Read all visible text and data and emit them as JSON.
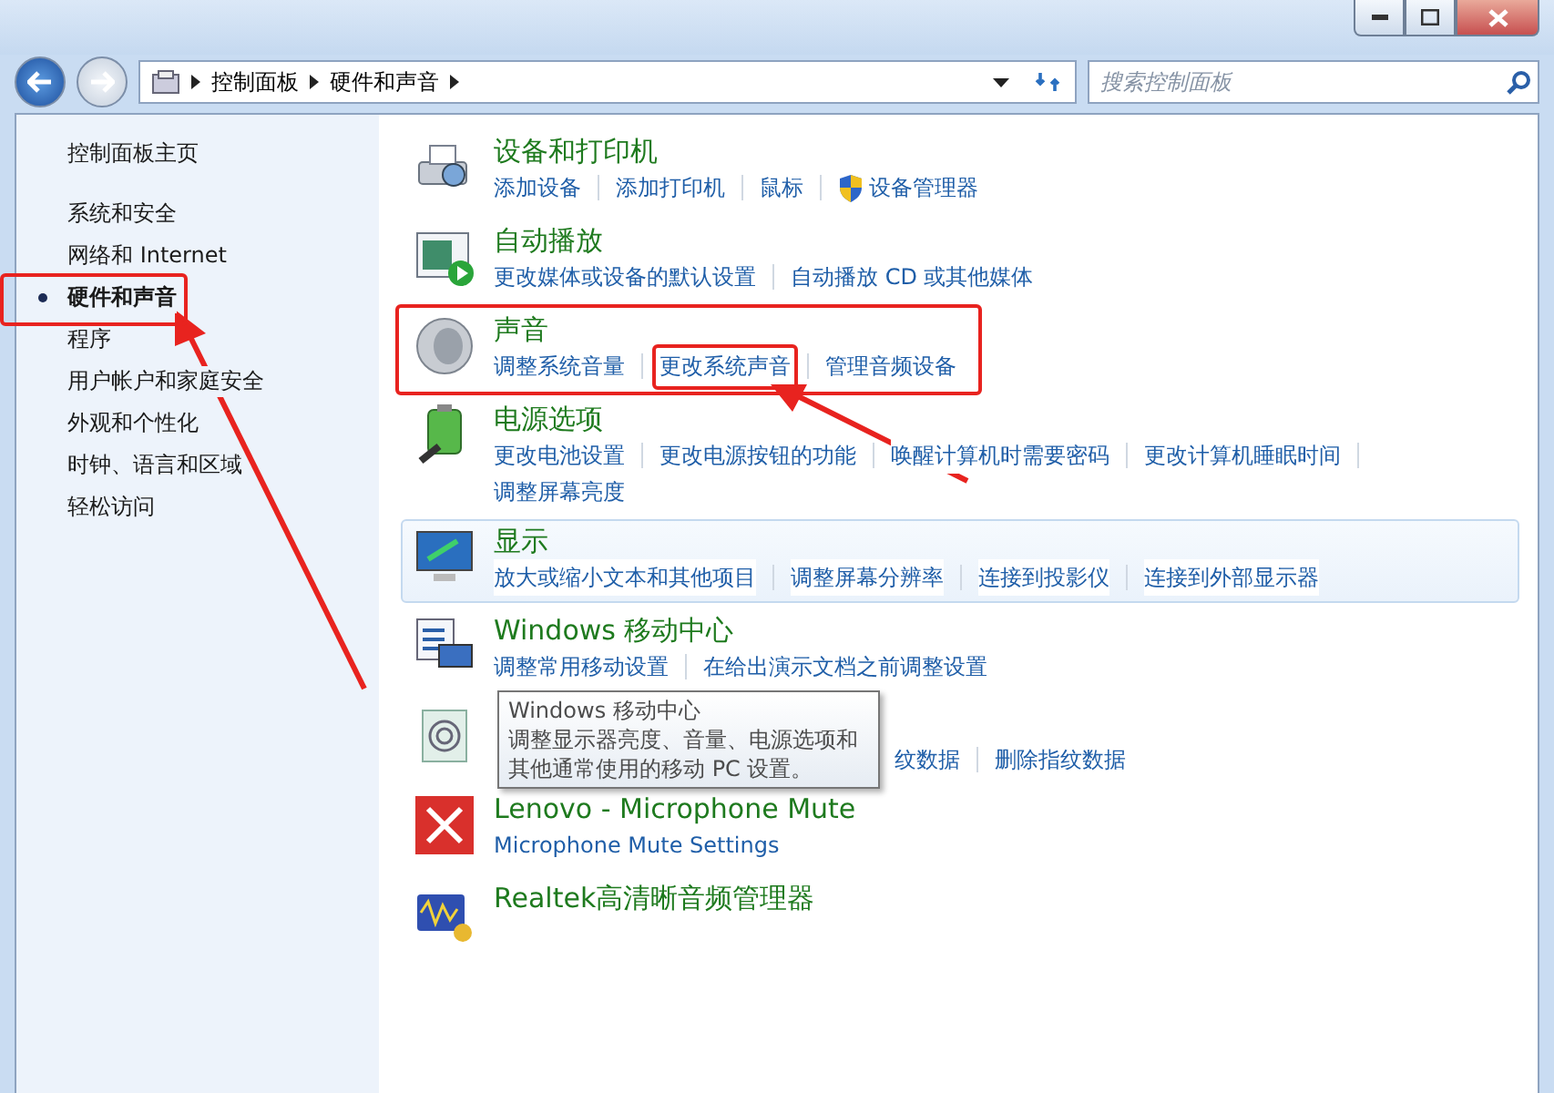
{
  "address_bar": {
    "breadcrumbs": [
      "控制面板",
      "硬件和声音"
    ],
    "search": {
      "placeholder": "搜索控制面板"
    }
  },
  "sidebar": {
    "home": "控制面板主页",
    "items": [
      {
        "label": "系统和安全",
        "selected": false,
        "annotated": false
      },
      {
        "label": "网络和 Internet",
        "selected": false,
        "annotated": false
      },
      {
        "label": "硬件和声音",
        "selected": true,
        "annotated": true
      },
      {
        "label": "程序",
        "selected": false,
        "annotated": false
      },
      {
        "label": "用户帐户和家庭安全",
        "selected": false,
        "annotated": false
      },
      {
        "label": "外观和个性化",
        "selected": false,
        "annotated": false
      },
      {
        "label": "时钟、语言和区域",
        "selected": false,
        "annotated": false
      },
      {
        "label": "轻松访问",
        "selected": false,
        "annotated": false
      }
    ]
  },
  "categories": [
    {
      "title": "设备和打印机",
      "highlighted": false,
      "annotated": false,
      "links": [
        {
          "text": "添加设备",
          "kind": "plain",
          "annotated": false
        },
        {
          "text": "添加打印机",
          "kind": "plain",
          "annotated": false
        },
        {
          "text": "鼠标",
          "kind": "plain",
          "annotated": false
        },
        {
          "text": "设备管理器",
          "kind": "shield",
          "annotated": false
        }
      ]
    },
    {
      "title": "自动播放",
      "highlighted": false,
      "annotated": false,
      "links": [
        {
          "text": "更改媒体或设备的默认设置",
          "kind": "plain",
          "annotated": false
        },
        {
          "text": "自动播放 CD 或其他媒体",
          "kind": "plain",
          "annotated": false
        }
      ]
    },
    {
      "title": "声音",
      "highlighted": false,
      "annotated": true,
      "links": [
        {
          "text": "调整系统音量",
          "kind": "plain",
          "annotated": false
        },
        {
          "text": "更改系统声音",
          "kind": "plain",
          "annotated": true
        },
        {
          "text": "管理音频设备",
          "kind": "plain",
          "annotated": false
        }
      ]
    },
    {
      "title": "电源选项",
      "highlighted": false,
      "annotated": false,
      "links": [
        {
          "text": "更改电池设置",
          "kind": "plain",
          "annotated": false
        },
        {
          "text": "更改电源按钮的功能",
          "kind": "plain",
          "annotated": false
        },
        {
          "text": "唤醒计算机时需要密码",
          "kind": "plain",
          "annotated": false
        },
        {
          "text": "更改计算机睡眠时间",
          "kind": "plain",
          "annotated": false
        },
        {
          "text": "调整屏幕亮度",
          "kind": "plain",
          "annotated": false
        }
      ]
    },
    {
      "title": "显示",
      "highlighted": true,
      "annotated": false,
      "links": [
        {
          "text": "放大或缩小文本和其他项目",
          "kind": "plain",
          "annotated": false
        },
        {
          "text": "调整屏幕分辨率",
          "kind": "plain",
          "annotated": false
        },
        {
          "text": "连接到投影仪",
          "kind": "plain",
          "annotated": false
        },
        {
          "text": "连接到外部显示器",
          "kind": "plain",
          "annotated": false
        }
      ]
    },
    {
      "title": "Windows 移动中心",
      "highlighted": false,
      "annotated": false,
      "links": [
        {
          "text": "调整常用移动设置",
          "kind": "plain",
          "annotated": false
        },
        {
          "text": "在给出演示文档之前调整设置",
          "kind": "plain",
          "annotated": false
        }
      ]
    },
    {
      "highlighted": false,
      "annotated": false,
      "links": [
        {
          "text": "纹数据",
          "kind": "plain",
          "annotated": false
        },
        {
          "text": "删除指纹数据",
          "kind": "plain",
          "annotated": false
        }
      ]
    },
    {
      "title": "Lenovo - Microphone Mute",
      "highlighted": false,
      "annotated": false,
      "links": [
        {
          "text": "Microphone Mute Settings",
          "kind": "plain",
          "annotated": false
        }
      ]
    },
    {
      "title": "Realtek高清晰音频管理器",
      "highlighted": false,
      "annotated": false
    }
  ],
  "tooltip": {
    "title": "Windows 移动中心",
    "text": "调整显示器亮度、音量、电源选项和其他通常使用的移动 PC 设置。"
  }
}
